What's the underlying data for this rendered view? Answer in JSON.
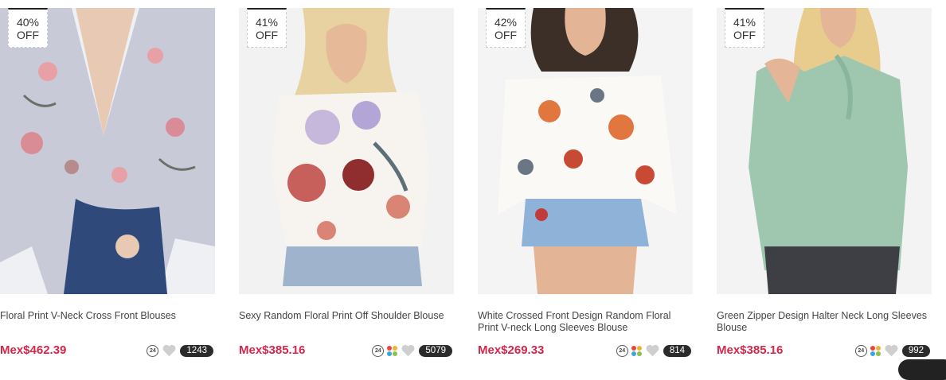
{
  "products": [
    {
      "discount_pct": "40%",
      "discount_word": "OFF",
      "title": "Floral Print V-Neck Cross Front Blouses",
      "price": "Mex$462.39",
      "likes": "1243",
      "ship_icon": "24",
      "has_color_swatch": false
    },
    {
      "discount_pct": "41%",
      "discount_word": "OFF",
      "title": "Sexy Random Floral Print Off Shoulder Blouse",
      "price": "Mex$385.16",
      "likes": "5079",
      "ship_icon": "24",
      "has_color_swatch": true
    },
    {
      "discount_pct": "42%",
      "discount_word": "OFF",
      "title": "White Crossed Front Design Random Floral Print V-neck Long Sleeves Blouse",
      "price": "Mex$269.33",
      "likes": "814",
      "ship_icon": "24",
      "has_color_swatch": true
    },
    {
      "discount_pct": "41%",
      "discount_word": "OFF",
      "title": "Green Zipper Design Halter Neck Long Sleeves Blouse",
      "price": "Mex$385.16",
      "likes": "992",
      "ship_icon": "24",
      "has_color_swatch": true
    }
  ],
  "colors": {
    "price": "#d4274b",
    "count_bg": "#2b2b2b",
    "heart": "#cfcfcf",
    "swatches": [
      "#e9453b",
      "#f2b134",
      "#3aa6dd",
      "#8bc34a"
    ]
  },
  "icons": {
    "ship": "24h-delivery-icon",
    "swatch": "color-swatch-icon",
    "like": "heart-icon"
  }
}
